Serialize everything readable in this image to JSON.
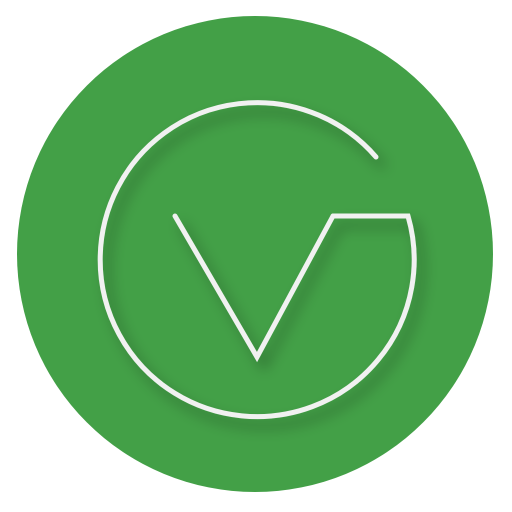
{
  "icon": {
    "name": "gv-logo-icon",
    "colors": {
      "background": "#ffffff",
      "disc": "#43a047",
      "stroke": "#f1f1f1",
      "shadow": "#1b5e20"
    }
  }
}
